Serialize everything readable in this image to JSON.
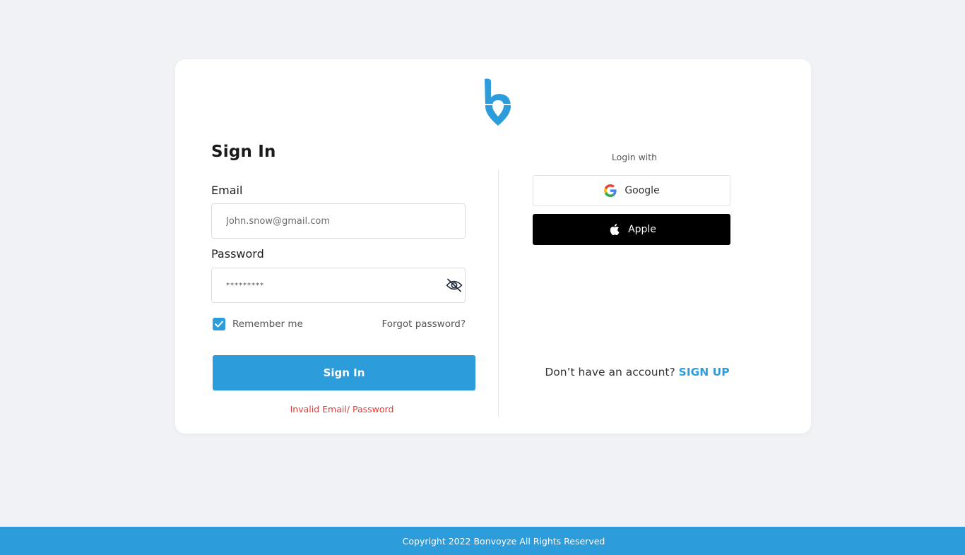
{
  "app": {
    "brand_color": "#2d9cdb",
    "logo_icon": "bonvoyze-b-pin-logo-icon"
  },
  "signin": {
    "title": "Sign In",
    "email_label": "Email",
    "email_placeholder": "John.snow@gmail.com",
    "password_label": "Password",
    "password_value": "*********",
    "password_toggle_icon": "eye-off-icon",
    "remember_me_label": "Remember me",
    "remember_me_checked": true,
    "forgot_password_label": "Forgot password?",
    "submit_label": "Sign In",
    "error_message": "Invalid Email/ Password",
    "error_color": "#e23b3b"
  },
  "social": {
    "heading": "Login with",
    "google_label": "Google",
    "google_icon": "google-icon",
    "apple_label": "Apple",
    "apple_icon": "apple-icon"
  },
  "signup": {
    "prompt": "Don’t have an account? ",
    "link_label": "SIGN UP"
  },
  "footer": {
    "copyright": "Copyright 2022 Bonvoyze All Rights Reserved"
  }
}
